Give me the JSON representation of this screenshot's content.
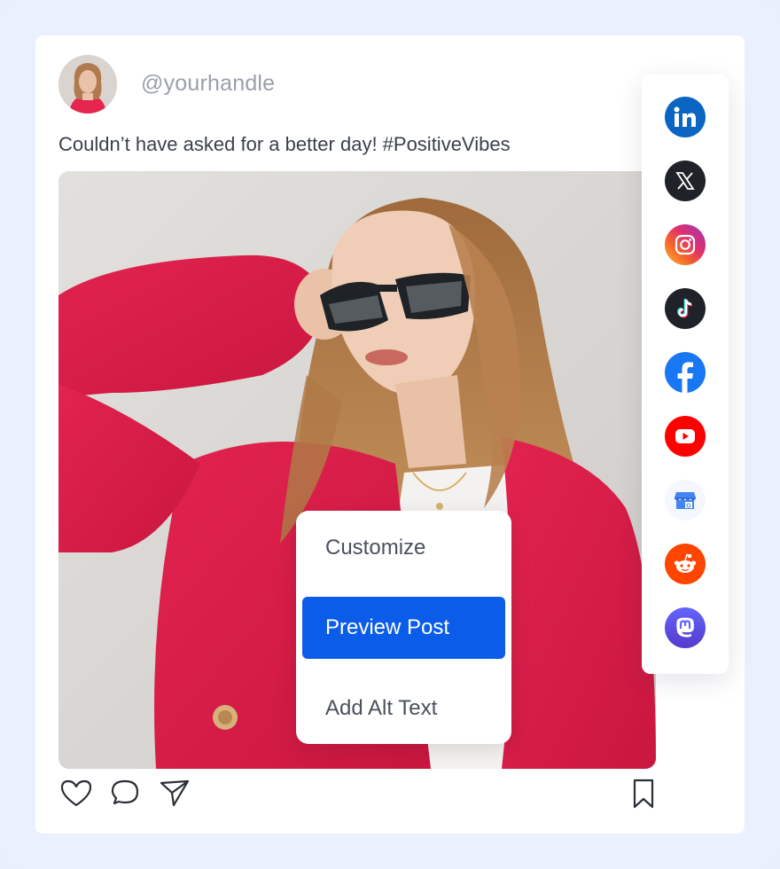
{
  "post": {
    "handle": "@yourhandle",
    "caption": "Couldn’t have asked for a better day! #PositiveVibes"
  },
  "menu": {
    "items": [
      {
        "label": "Customize",
        "active": false
      },
      {
        "label": "Preview Post",
        "active": true
      },
      {
        "label": "Add Alt Text",
        "active": false
      }
    ]
  },
  "social_platforms": [
    {
      "icon": "linkedin-icon",
      "color": "#0a66c2"
    },
    {
      "icon": "x-icon",
      "color": "#1f2228"
    },
    {
      "icon": "instagram-icon",
      "color": "#e1306c"
    },
    {
      "icon": "tiktok-icon",
      "color": "#1f2228"
    },
    {
      "icon": "facebook-icon",
      "color": "#1877f2"
    },
    {
      "icon": "youtube-icon",
      "color": "#ff0000"
    },
    {
      "icon": "google-business-icon",
      "color": "#4285f4"
    },
    {
      "icon": "reddit-icon",
      "color": "#ff4500"
    },
    {
      "icon": "mastodon-icon",
      "color": "#6364ff"
    }
  ],
  "colors": {
    "accent": "#0b5ce8",
    "background": "#eaf0fd"
  }
}
